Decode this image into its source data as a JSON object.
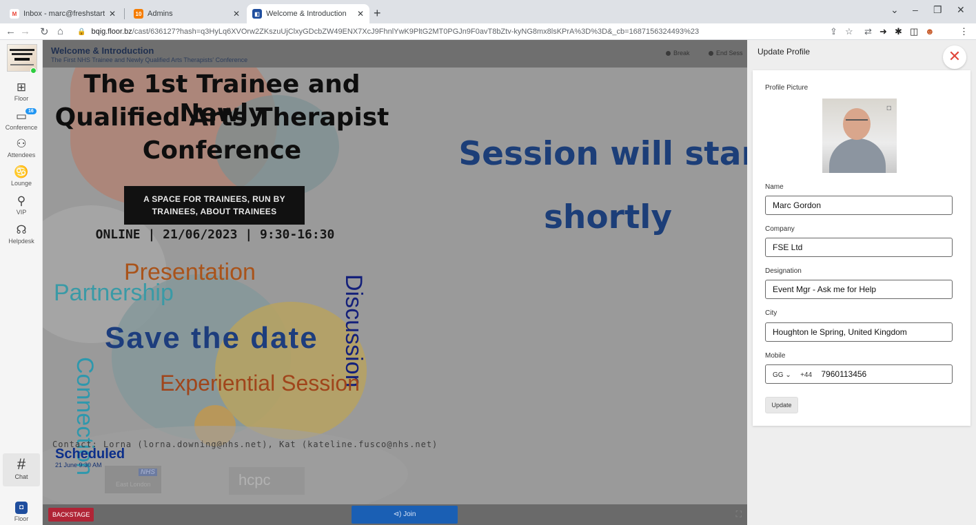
{
  "browser": {
    "tabs": [
      {
        "title": "Inbox - marc@freshstartevents.u",
        "fav": "M",
        "fav_color": "#ea4335"
      },
      {
        "title": "Admins",
        "fav": "10",
        "fav_color": "#f57c00"
      },
      {
        "title": "Welcome & Introduction",
        "fav": "◧",
        "fav_color": "#1f4e9e"
      }
    ],
    "url_host": "bqig.floor.bz",
    "url_path": "/cast/636127?hash=q3HyLq6XVOrw2ZKszuUjClxyGDcbZW49ENX7XcJ9FhnlYwK9PltG2MT0PGJn9F0avT8bZtv-kyNG8mx8lsKPrA%3D%3D&_cb=1687156324493%23"
  },
  "sidebar": {
    "items": [
      {
        "label": "Floor",
        "icon": "map-icon",
        "glyph": "🗺"
      },
      {
        "label": "Conference",
        "icon": "video-icon",
        "glyph": "▭",
        "badge": "16"
      },
      {
        "label": "Attendees",
        "icon": "people-icon",
        "glyph": "ஃ"
      },
      {
        "label": "Lounge",
        "icon": "sofa-icon",
        "glyph": "⥃"
      },
      {
        "label": "VIP",
        "icon": "microphone-icon",
        "glyph": "🎙"
      },
      {
        "label": "Helpdesk",
        "icon": "support-icon",
        "glyph": "☊"
      }
    ],
    "chat_label": "Chat",
    "floor_label": "Floor"
  },
  "stage": {
    "title": "Welcome & Introduction",
    "subtitle": "The First NHS Trainee and Newly Qualified Arts Therapists' Conference",
    "break_label": "Break",
    "end_label": "End Sess",
    "backstage_label": "BACKSTAGE",
    "join_label": "⊲) Join",
    "poster": {
      "title_lines": [
        "The 1st Trainee and Newly",
        "Qualified Arts Therapist",
        "Conference"
      ],
      "box_lines": [
        "A SPACE FOR TRAINEES, RUN BY",
        "TRAINEES, ABOUT TRAINEES"
      ],
      "online": "ONLINE | 21/06/2023 | 9:30-16:30",
      "presentation": "Presentation",
      "partnership": "Partnership",
      "save": "Save the date",
      "experiential": "Experiential Session",
      "connection": "Connection",
      "discussion": "Discussion",
      "contact": "Contact: Lorna (lorna.downing@nhs.net), Kat (kateline.fusco@nhs.net)",
      "session_text_1": "Session will star",
      "session_text_2": "shortly",
      "nhs": "NHS",
      "nhs_sub": "East London",
      "hcpc": "hcpc"
    },
    "scheduled_label": "Scheduled",
    "scheduled_date": "21 June 9:30 AM"
  },
  "profile": {
    "panel_title": "Update Profile",
    "picture_label": "Profile Picture",
    "name_label": "Name",
    "name_value": "Marc Gordon",
    "company_label": "Company",
    "company_value": "FSE Ltd",
    "designation_label": "Designation",
    "designation_value": "Event Mgr - Ask me for Help",
    "city_label": "City",
    "city_value": "Houghton le Spring, United Kingdom",
    "mobile_label": "Mobile",
    "mobile_country": "GG ⌄",
    "mobile_dial": "+44",
    "mobile_value": "7960113456",
    "update_label": "Update"
  }
}
